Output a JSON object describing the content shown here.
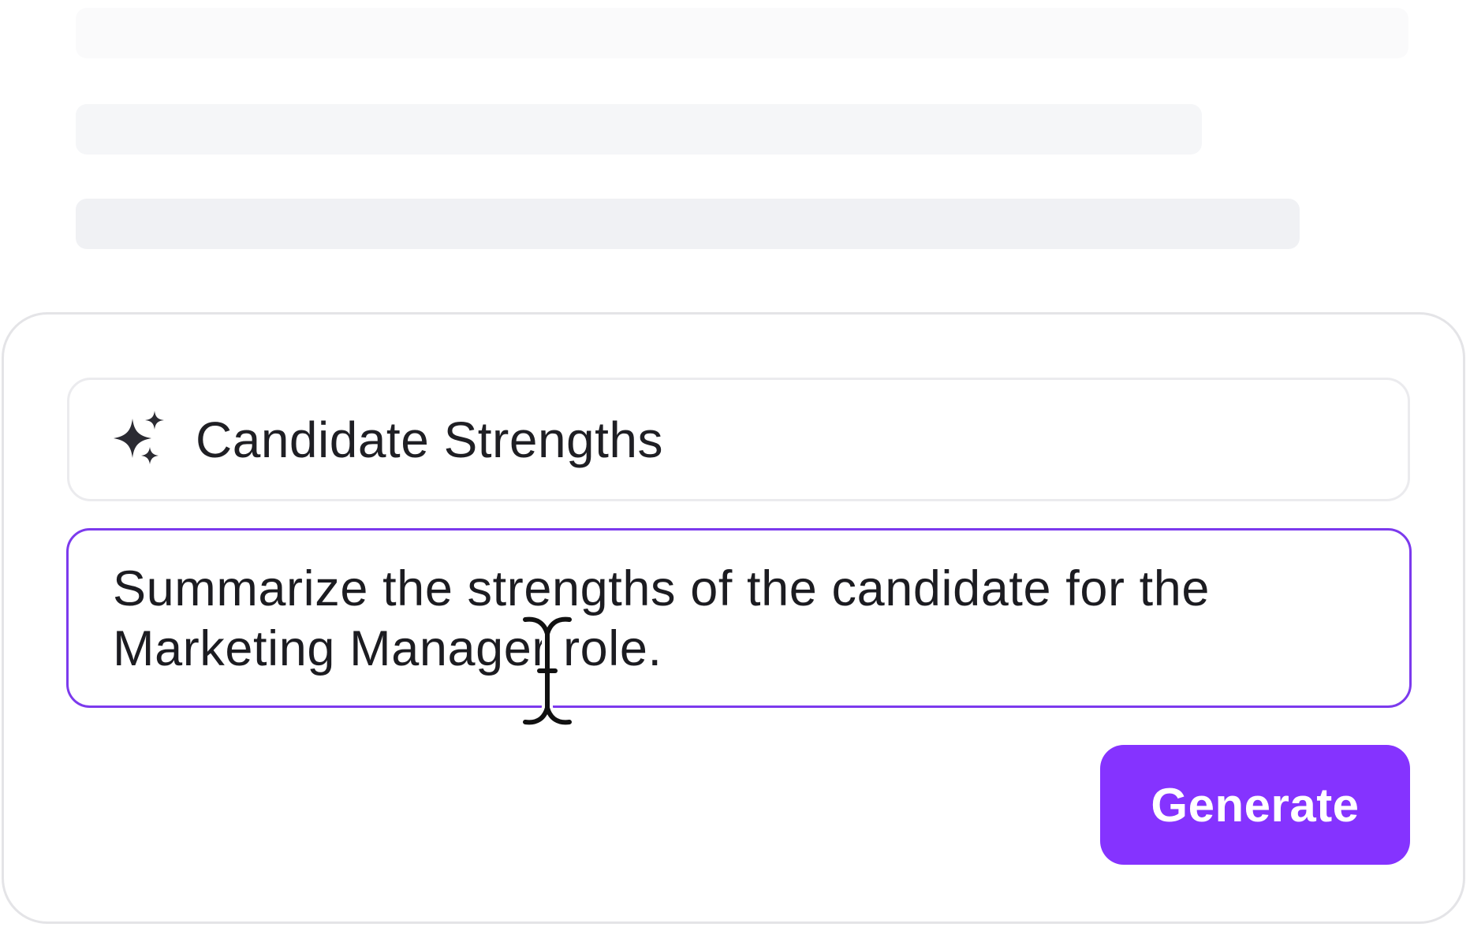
{
  "field_title": {
    "icon": "sparkle-icon",
    "value": "Candidate Strengths"
  },
  "prompt": {
    "value": "Summarize the strengths of the candidate for the Marketing Manager role."
  },
  "actions": {
    "generate_label": "Generate"
  },
  "colors": {
    "accent": "#8533ff",
    "focus_border": "#7c3aed",
    "text": "#1f1f24",
    "card_border": "#e4e4e7"
  },
  "cursor": {
    "icon": "text-cursor-icon"
  }
}
